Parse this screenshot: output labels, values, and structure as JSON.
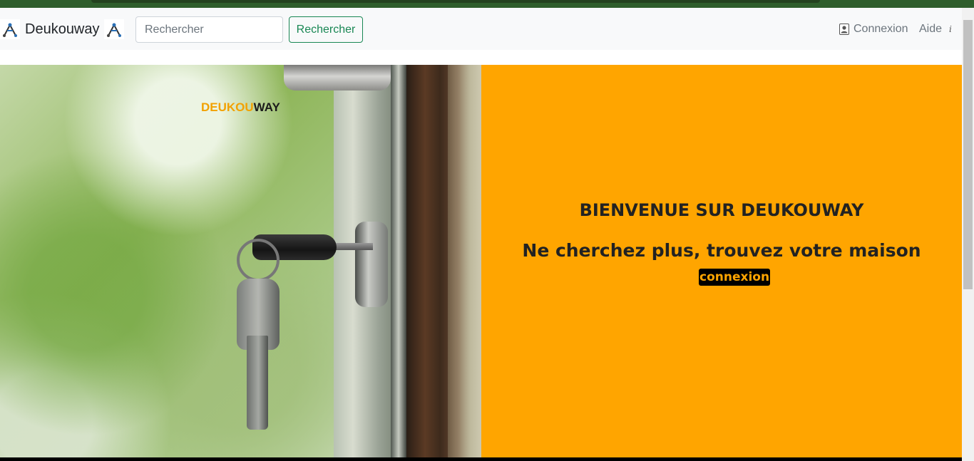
{
  "brand": {
    "name": "Deukouway"
  },
  "search": {
    "placeholder": "Rechercher",
    "button_label": "Rechercher"
  },
  "nav": {
    "login": "Connexion",
    "help": "Aide",
    "info": "i"
  },
  "hero": {
    "photo_logo_part1": "DEUKOU",
    "photo_logo_part2": "WAY",
    "title": "BIENVENUE SUR DEUKOUWAY",
    "subtitle": "Ne cherchez plus, trouvez votre maison",
    "cta_label": "connexion"
  },
  "colors": {
    "accent": "#ffa500",
    "button": "#198754",
    "topbar": "#2f5e2c"
  }
}
